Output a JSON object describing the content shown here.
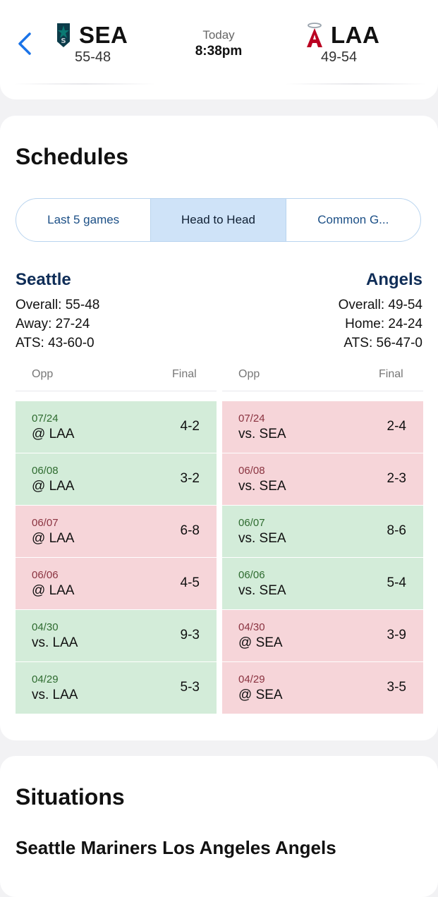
{
  "header": {
    "away": {
      "abbr": "SEA",
      "record": "55-48"
    },
    "home": {
      "abbr": "LAA",
      "record": "49-54"
    },
    "day": "Today",
    "time": "8:38pm"
  },
  "schedules": {
    "title": "Schedules",
    "tabs": [
      "Last 5 games",
      "Head to Head",
      "Common G..."
    ],
    "active_tab": "Head to Head",
    "left_team": {
      "name": "Seattle",
      "overall": "Overall: 55-48",
      "split": "Away: 27-24",
      "ats": "ATS: 43-60-0"
    },
    "right_team": {
      "name": "Angels",
      "overall": "Overall: 49-54",
      "split": "Home: 24-24",
      "ats": "ATS: 56-47-0"
    },
    "col_opp": "Opp",
    "col_final": "Final",
    "left_games": [
      {
        "date": "07/24",
        "opp": "@ LAA",
        "score": "4-2",
        "result": "win"
      },
      {
        "date": "06/08",
        "opp": "@ LAA",
        "score": "3-2",
        "result": "win"
      },
      {
        "date": "06/07",
        "opp": "@ LAA",
        "score": "6-8",
        "result": "loss"
      },
      {
        "date": "06/06",
        "opp": "@ LAA",
        "score": "4-5",
        "result": "loss"
      },
      {
        "date": "04/30",
        "opp": "vs. LAA",
        "score": "9-3",
        "result": "win"
      },
      {
        "date": "04/29",
        "opp": "vs. LAA",
        "score": "5-3",
        "result": "win"
      }
    ],
    "right_games": [
      {
        "date": "07/24",
        "opp": "vs. SEA",
        "score": "2-4",
        "result": "loss"
      },
      {
        "date": "06/08",
        "opp": "vs. SEA",
        "score": "2-3",
        "result": "loss"
      },
      {
        "date": "06/07",
        "opp": "vs. SEA",
        "score": "8-6",
        "result": "win"
      },
      {
        "date": "06/06",
        "opp": "vs. SEA",
        "score": "5-4",
        "result": "win"
      },
      {
        "date": "04/30",
        "opp": "@ SEA",
        "score": "3-9",
        "result": "loss"
      },
      {
        "date": "04/29",
        "opp": "@ SEA",
        "score": "3-5",
        "result": "loss"
      }
    ]
  },
  "situations": {
    "title": "Situations",
    "partial_text": "Seattle Mariners                Los Angeles Angels"
  },
  "colors": {
    "accent": "#1a73e8",
    "win": "#d3ecd9",
    "loss": "#f6d5d9",
    "team_name": "#0f2d57"
  }
}
